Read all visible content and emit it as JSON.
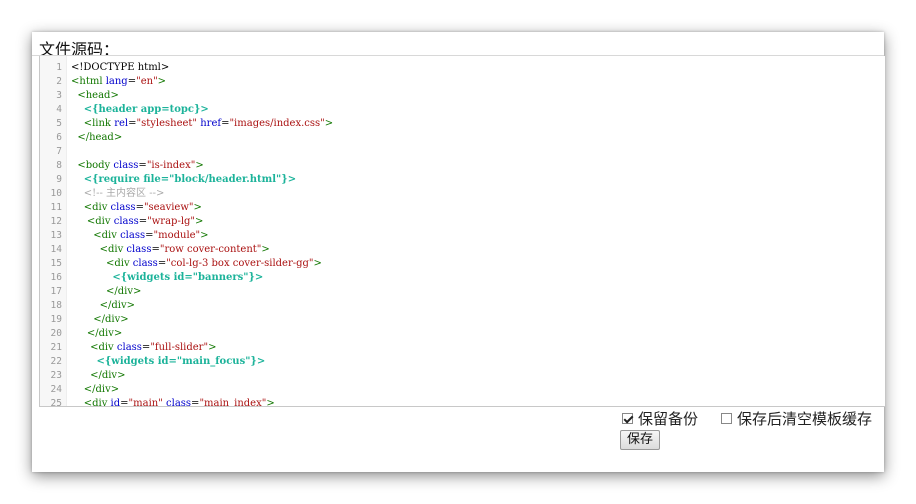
{
  "panel": {
    "title": "文件源码："
  },
  "editor": {
    "lines": [
      {
        "n": "1",
        "indent": "",
        "parts": [
          [
            "plain",
            "<!DOCTYPE html>"
          ]
        ]
      },
      {
        "n": "2",
        "indent": "",
        "parts": [
          [
            "tag",
            "<html "
          ],
          [
            "attr",
            "lang"
          ],
          [
            "plain",
            "="
          ],
          [
            "str",
            "\"en\""
          ],
          [
            "tag",
            ">"
          ]
        ]
      },
      {
        "n": "3",
        "indent": "  ",
        "parts": [
          [
            "tag",
            "<head>"
          ]
        ]
      },
      {
        "n": "4",
        "indent": "    ",
        "parts": [
          [
            "tpl",
            "<{header app=topc}>"
          ]
        ]
      },
      {
        "n": "5",
        "indent": "    ",
        "parts": [
          [
            "tag",
            "<link "
          ],
          [
            "attr",
            "rel"
          ],
          [
            "plain",
            "="
          ],
          [
            "str",
            "\"stylesheet\""
          ],
          [
            "plain",
            " "
          ],
          [
            "attr",
            "href"
          ],
          [
            "plain",
            "="
          ],
          [
            "str",
            "\"images/index.css\""
          ],
          [
            "tag",
            ">"
          ]
        ]
      },
      {
        "n": "6",
        "indent": "  ",
        "parts": [
          [
            "tag",
            "</head>"
          ]
        ]
      },
      {
        "n": "7",
        "indent": "",
        "parts": []
      },
      {
        "n": "8",
        "indent": "  ",
        "parts": [
          [
            "tag",
            "<body "
          ],
          [
            "attr",
            "class"
          ],
          [
            "plain",
            "="
          ],
          [
            "str",
            "\"is-index\""
          ],
          [
            "tag",
            ">"
          ]
        ]
      },
      {
        "n": "9",
        "indent": "    ",
        "parts": [
          [
            "tpl",
            "<{require file=\"block/header.html\"}>"
          ]
        ]
      },
      {
        "n": "10",
        "indent": "    ",
        "parts": [
          [
            "cmt",
            "<!-- 主内容区 -->"
          ]
        ]
      },
      {
        "n": "11",
        "indent": "    ",
        "parts": [
          [
            "tag",
            "<div "
          ],
          [
            "attr",
            "class"
          ],
          [
            "plain",
            "="
          ],
          [
            "str",
            "\"seaview\""
          ],
          [
            "tag",
            ">"
          ]
        ]
      },
      {
        "n": "12",
        "indent": "     ",
        "parts": [
          [
            "tag",
            "<div "
          ],
          [
            "attr",
            "class"
          ],
          [
            "plain",
            "="
          ],
          [
            "str",
            "\"wrap-lg\""
          ],
          [
            "tag",
            ">"
          ]
        ]
      },
      {
        "n": "13",
        "indent": "       ",
        "parts": [
          [
            "tag",
            "<div "
          ],
          [
            "attr",
            "class"
          ],
          [
            "plain",
            "="
          ],
          [
            "str",
            "\"module\""
          ],
          [
            "tag",
            ">"
          ]
        ]
      },
      {
        "n": "14",
        "indent": "         ",
        "parts": [
          [
            "tag",
            "<div "
          ],
          [
            "attr",
            "class"
          ],
          [
            "plain",
            "="
          ],
          [
            "str",
            "\"row cover-content\""
          ],
          [
            "tag",
            ">"
          ]
        ]
      },
      {
        "n": "15",
        "indent": "           ",
        "parts": [
          [
            "tag",
            "<div "
          ],
          [
            "attr",
            "class"
          ],
          [
            "plain",
            "="
          ],
          [
            "str",
            "\"col-lg-3 box cover-silder-gg\""
          ],
          [
            "tag",
            ">"
          ]
        ]
      },
      {
        "n": "16",
        "indent": "             ",
        "parts": [
          [
            "tpl",
            "<{widgets id=\"banners\"}>"
          ]
        ]
      },
      {
        "n": "17",
        "indent": "           ",
        "parts": [
          [
            "tag",
            "</div>"
          ]
        ]
      },
      {
        "n": "18",
        "indent": "         ",
        "parts": [
          [
            "tag",
            "</div>"
          ]
        ]
      },
      {
        "n": "19",
        "indent": "       ",
        "parts": [
          [
            "tag",
            "</div>"
          ]
        ]
      },
      {
        "n": "20",
        "indent": "     ",
        "parts": [
          [
            "tag",
            "</div>"
          ]
        ]
      },
      {
        "n": "21",
        "indent": "      ",
        "parts": [
          [
            "tag",
            "<div "
          ],
          [
            "attr",
            "class"
          ],
          [
            "plain",
            "="
          ],
          [
            "str",
            "\"full-slider\""
          ],
          [
            "tag",
            ">"
          ]
        ]
      },
      {
        "n": "22",
        "indent": "        ",
        "parts": [
          [
            "tpl",
            "<{widgets id=\"main_focus\"}>"
          ]
        ]
      },
      {
        "n": "23",
        "indent": "      ",
        "parts": [
          [
            "tag",
            "</div>"
          ]
        ]
      },
      {
        "n": "24",
        "indent": "    ",
        "parts": [
          [
            "tag",
            "</div>"
          ]
        ]
      },
      {
        "n": "25",
        "indent": "    ",
        "parts": [
          [
            "tag",
            "<div "
          ],
          [
            "attr",
            "id"
          ],
          [
            "plain",
            "="
          ],
          [
            "str",
            "\"main\""
          ],
          [
            "plain",
            " "
          ],
          [
            "attr",
            "class"
          ],
          [
            "plain",
            "="
          ],
          [
            "str",
            "\"main_index\""
          ],
          [
            "tag",
            ">"
          ]
        ]
      }
    ]
  },
  "options": {
    "keep_backup": {
      "label": "保留备份",
      "checked": true
    },
    "clear_cache": {
      "label": "保存后清空模板缓存",
      "checked": false
    }
  },
  "actions": {
    "save_label": "保存"
  }
}
